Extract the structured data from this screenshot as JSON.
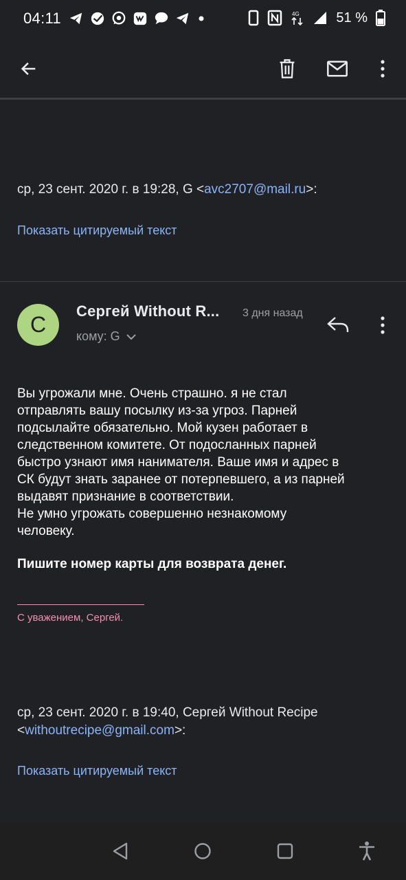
{
  "status_bar": {
    "time": "04:11",
    "battery_text": "51 %",
    "network_label": "4G",
    "icons_left": [
      "telegram-icon",
      "sberbank-icon",
      "whatsapp-icon",
      "vk-icon",
      "chat-icon",
      "telegram-icon",
      "dot-icon"
    ],
    "icons_right": [
      "vibrate-icon",
      "nfc-icon",
      "signal-icon",
      "battery-icon"
    ]
  },
  "app_bar": {
    "icons": [
      "back-arrow-icon",
      "trash-icon",
      "mail-unread-icon",
      "more-vert-icon"
    ]
  },
  "previous_message": {
    "quote_header_prefix": "ср, 23 сент. 2020 г. в 19:28, G <",
    "quote_header_email": "avc2707@mail.ru",
    "quote_header_suffix": ">:",
    "show_quoted": "Показать цитируемый текст"
  },
  "message": {
    "avatar_letter": "С",
    "sender": "Сергей Without R...",
    "date_ago": "3 дня назад",
    "to_label": "кому: G",
    "body_lines": [
      "Вы угрожали мне.  Очень страшно. я не стал",
      "отправлять вашу посылку  из-за угроз.  Парней",
      "подсылайте обязательно. Мой кузен работает в",
      "следственном комитете.  От подосланных парней",
      "быстро узнают  имя нанимателя.  Ваше имя и адрес в",
      "СК будут знать заранее от потерпевшего, а из парней",
      "выдавят признание в соответствии.",
      "Не умно угрожать совершенно незнакомому",
      "человеку."
    ],
    "body_bold": "Пишите номер карты для возврата денег.",
    "signature": "С уважением, Сергей.",
    "quote_header_line1": "ср, 23 сент. 2020 г. в 19:40, Сергей Without Recipe",
    "quote_header_line2_prefix": "<",
    "quote_header_email": "withoutrecipe@gmail.com",
    "quote_header_line2_suffix": ">:",
    "show_quoted": "Показать цитируемый текст"
  },
  "colors": {
    "background": "#202124",
    "link": "#8ab4f8",
    "avatar": "#aed581",
    "signature": "#f48fb1"
  },
  "nav_bar": {
    "icons": [
      "nav-back-icon",
      "nav-home-icon",
      "nav-recents-icon",
      "accessibility-icon"
    ]
  }
}
